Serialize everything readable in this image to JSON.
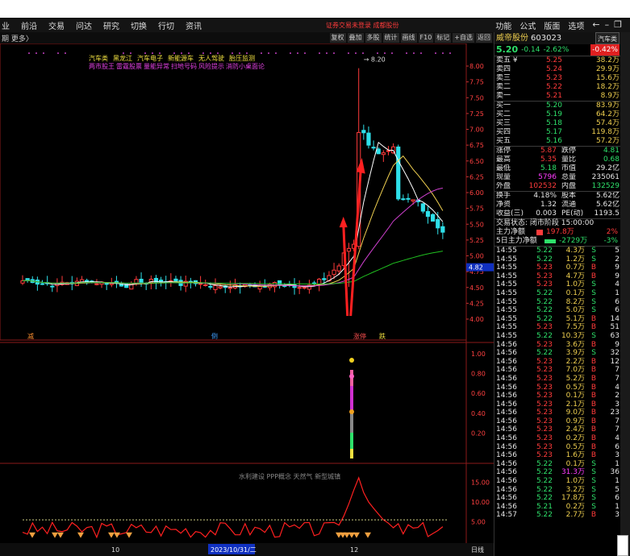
{
  "menubar": {
    "left": [
      "业",
      "前沿",
      "交易",
      "问达",
      "研究",
      "切换",
      "行切",
      "资讯"
    ],
    "center_notice": "证券交易未登录 成都股份",
    "right": [
      "功能",
      "公式",
      "版面",
      "选项"
    ],
    "win_icons": [
      "back-arrow-icon",
      "minimize-icon",
      "restore-icon"
    ]
  },
  "toolbar": {
    "period_label": "期 更多〉",
    "buttons": [
      "复权",
      "叠加",
      "多股",
      "统计",
      "画线",
      "F10",
      "标记",
      "+自选",
      "返回"
    ]
  },
  "chart": {
    "concept_tags_row1": [
      "汽车类",
      "黑龙江",
      "汽车电子",
      "新能源车",
      "无人驾驶",
      "胎压监测"
    ],
    "concept_tags_row2": [
      "两市股王",
      "雷霆股票",
      "量能异常",
      "扫地号码",
      "风险提示",
      "消防小桌面论"
    ],
    "price_axis": [
      "8.00",
      "7.75",
      "7.50",
      "7.25",
      "7.00",
      "6.75",
      "6.50",
      "6.25",
      "6.00",
      "5.75",
      "5.50",
      "5.25",
      "5.00",
      "4.75",
      "4.50",
      "4.25",
      "4.00"
    ],
    "price_marker": "4.82",
    "high_label": "8.20",
    "signal_row": {
      "left": "减",
      "mid": "倒",
      "right1": "涨停",
      "right2": "跌"
    },
    "sub1_axis": [
      "1.00",
      "0.80",
      "0.60",
      "0.40",
      "0.20"
    ],
    "sub2_axis": [
      "15.00",
      "10.00",
      "5.00"
    ],
    "sub2_title": "水利建设 PPP概念 天然气 新型城镇",
    "date_labels": {
      "left": "10",
      "highlight": "2023/10/31/二",
      "right": "12"
    },
    "period_tab": "日线"
  },
  "panel": {
    "stock_name": "威帝股份",
    "stock_code": "603023",
    "sector_badge": "汽车类",
    "price": "5.20",
    "change": "-0.14",
    "change_pct": "-2.62%",
    "sector_pct": "-0.42%",
    "asks": [
      {
        "label": "卖五 ¥",
        "price": "5.25",
        "vol": "38.2万"
      },
      {
        "label": "卖四",
        "price": "5.24",
        "vol": "29.9万"
      },
      {
        "label": "卖三",
        "price": "5.23",
        "vol": "15.6万"
      },
      {
        "label": "卖二",
        "price": "5.22",
        "vol": "18.2万"
      },
      {
        "label": "卖一",
        "price": "5.21",
        "vol": "8.9万"
      }
    ],
    "bids": [
      {
        "label": "买一",
        "price": "5.20",
        "vol": "83.9万"
      },
      {
        "label": "买二",
        "price": "5.19",
        "vol": "64.2万"
      },
      {
        "label": "买三",
        "price": "5.18",
        "vol": "57.4万"
      },
      {
        "label": "买四",
        "price": "5.17",
        "vol": "119.8万"
      },
      {
        "label": "买五",
        "price": "5.16",
        "vol": "57.2万"
      }
    ],
    "stats": [
      {
        "k1": "涨停",
        "v1": "5.87",
        "c1": "red",
        "k2": "跌停",
        "v2": "4.81",
        "c2": "green"
      },
      {
        "k1": "最高",
        "v1": "5.35",
        "c1": "red",
        "k2": "量比",
        "v2": "0.68",
        "c2": "green"
      },
      {
        "k1": "最低",
        "v1": "5.18",
        "c1": "green",
        "k2": "市值",
        "v2": "29.2亿",
        "c2": "white"
      },
      {
        "k1": "现量",
        "v1": "5796",
        "c1": "magenta",
        "k2": "总量",
        "v2": "235061",
        "c2": "white"
      },
      {
        "k1": "外盘",
        "v1": "102532",
        "c1": "red",
        "k2": "内盘",
        "v2": "132529",
        "c2": "green"
      }
    ],
    "stats2": [
      {
        "k1": "换手",
        "v1": "4.18%",
        "k2": "股本",
        "v2": "5.62亿"
      },
      {
        "k1": "净资",
        "v1": "1.32",
        "k2": "流通",
        "v2": "5.62亿"
      },
      {
        "k1": "收益(三)",
        "v1": "0.003",
        "k2": "PE(动)",
        "v2": "1193.5"
      }
    ],
    "trade_status": "交易状态: 闭市阶段 15:00:00",
    "main_flow": {
      "label": "主力净额",
      "value": "197.8万",
      "pct": "2%"
    },
    "flow5": {
      "label": "5日主力净额",
      "value": "-2729万",
      "pct": "-3%"
    },
    "ticks": [
      {
        "t": "14:55",
        "p": "5.22",
        "v": "4.3万",
        "d": "S",
        "n": "5"
      },
      {
        "t": "14:55",
        "p": "5.22",
        "v": "1.2万",
        "d": "S",
        "n": "2"
      },
      {
        "t": "14:55",
        "p": "5.23",
        "v": "0.7万",
        "d": "B",
        "n": "9"
      },
      {
        "t": "14:55",
        "p": "5.23",
        "v": "4.7万",
        "d": "B",
        "n": "9"
      },
      {
        "t": "14:55",
        "p": "5.23",
        "v": "1.0万",
        "d": "S",
        "n": "4"
      },
      {
        "t": "14:55",
        "p": "5.22",
        "v": "0.1万",
        "d": "S",
        "n": "1"
      },
      {
        "t": "14:55",
        "p": "5.22",
        "v": "8.2万",
        "d": "S",
        "n": "6"
      },
      {
        "t": "14:55",
        "p": "5.22",
        "v": "5.0万",
        "d": "S",
        "n": "6"
      },
      {
        "t": "14:55",
        "p": "5.22",
        "v": "5.1万",
        "d": "B",
        "n": "14"
      },
      {
        "t": "14:55",
        "p": "5.23",
        "v": "7.5万",
        "d": "B",
        "n": "51"
      },
      {
        "t": "14:55",
        "p": "5.22",
        "v": "10.3万",
        "d": "S",
        "n": "63"
      },
      {
        "t": "14:56",
        "p": "5.23",
        "v": "3.6万",
        "d": "B",
        "n": "9"
      },
      {
        "t": "14:56",
        "p": "5.22",
        "v": "3.9万",
        "d": "S",
        "n": "32"
      },
      {
        "t": "14:56",
        "p": "5.23",
        "v": "2.2万",
        "d": "B",
        "n": "12"
      },
      {
        "t": "14:56",
        "p": "5.23",
        "v": "7.0万",
        "d": "B",
        "n": "7"
      },
      {
        "t": "14:56",
        "p": "5.23",
        "v": "5.2万",
        "d": "B",
        "n": "7"
      },
      {
        "t": "14:56",
        "p": "5.23",
        "v": "0.5万",
        "d": "B",
        "n": "4"
      },
      {
        "t": "14:56",
        "p": "5.23",
        "v": "0.1万",
        "d": "B",
        "n": "2"
      },
      {
        "t": "14:56",
        "p": "5.23",
        "v": "2.1万",
        "d": "B",
        "n": "3"
      },
      {
        "t": "14:56",
        "p": "5.23",
        "v": "9.0万",
        "d": "B",
        "n": "23"
      },
      {
        "t": "14:56",
        "p": "5.23",
        "v": "0.9万",
        "d": "B",
        "n": "7"
      },
      {
        "t": "14:56",
        "p": "5.23",
        "v": "2.4万",
        "d": "B",
        "n": "7"
      },
      {
        "t": "14:56",
        "p": "5.23",
        "v": "0.2万",
        "d": "B",
        "n": "4"
      },
      {
        "t": "14:56",
        "p": "5.23",
        "v": "0.5万",
        "d": "B",
        "n": "6"
      },
      {
        "t": "14:56",
        "p": "5.23",
        "v": "1.6万",
        "d": "B",
        "n": "3"
      },
      {
        "t": "14:56",
        "p": "5.22",
        "v": "0.1万",
        "d": "S",
        "n": "1"
      },
      {
        "t": "14:56",
        "p": "5.22",
        "v": "31.3万",
        "d": "S",
        "n": "36"
      },
      {
        "t": "14:56",
        "p": "5.22",
        "v": "1.0万",
        "d": "S",
        "n": "1"
      },
      {
        "t": "14:56",
        "p": "5.22",
        "v": "3.2万",
        "d": "S",
        "n": "5"
      },
      {
        "t": "14:56",
        "p": "5.22",
        "v": "17.8万",
        "d": "S",
        "n": "6"
      },
      {
        "t": "14:56",
        "p": "5.21",
        "v": "0.2万",
        "d": "S",
        "n": "1"
      },
      {
        "t": "14:57",
        "p": "5.22",
        "v": "2.7万",
        "d": "B",
        "n": "3"
      }
    ]
  },
  "colors": {
    "up": "#ff3b3b",
    "down": "#2ee0ea",
    "ma5": "#ffffff",
    "ma10": "#f0d050",
    "ma20": "#d040d0",
    "ma60": "#20c020",
    "accent": "#ff3bff"
  }
}
